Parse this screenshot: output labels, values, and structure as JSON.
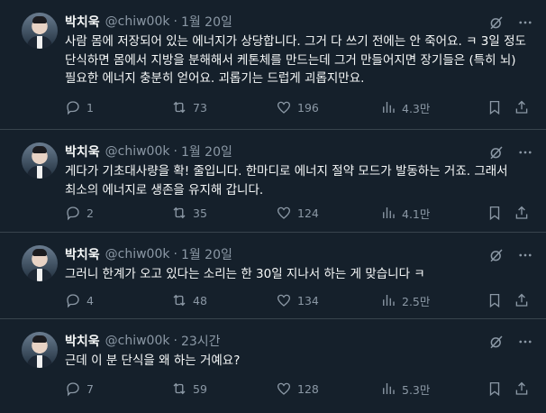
{
  "tweets": [
    {
      "author": "박치욱",
      "handle": "@chiw00k",
      "separator": "·",
      "time": "1월 20일",
      "text": "사람 몸에 저장되어 있는 에너지가 상당합니다. 그거 다 쓰기 전에는 안 죽어요. ㅋ 3일 정도 단식하면 몸에서 지방을 분해해서 케톤체를 만드는데 그거 만들어지면 장기들은 (특히 뇌) 필요한 에너지 충분히 얻어요. 괴롭기는 드럽게 괴롭지만요.",
      "replies": "1",
      "retweets": "73",
      "likes": "196",
      "views": "4.3만"
    },
    {
      "author": "박치욱",
      "handle": "@chiw00k",
      "separator": "·",
      "time": "1월 20일",
      "text": "게다가 기초대사량을 확! 줄입니다. 한마디로 에너지 절약 모드가 발동하는 거죠. 그래서 최소의 에너지로 생존을 유지해 갑니다.",
      "replies": "2",
      "retweets": "35",
      "likes": "124",
      "views": "4.1만"
    },
    {
      "author": "박치욱",
      "handle": "@chiw00k",
      "separator": "·",
      "time": "1월 20일",
      "text": "그러니 한계가 오고 있다는 소리는 한 30일 지나서 하는 게 맞습니다 ㅋ",
      "replies": "4",
      "retweets": "48",
      "likes": "134",
      "views": "2.5만"
    },
    {
      "author": "박치욱",
      "handle": "@chiw00k",
      "separator": "·",
      "time": "23시간",
      "text": "근데 이 분 단식을 왜 하는 거예요?",
      "replies": "7",
      "retweets": "59",
      "likes": "128",
      "views": "5.3만"
    }
  ],
  "icons": {
    "reply": "reply-icon",
    "retweet": "retweet-icon",
    "like": "heart-icon",
    "views": "views-icon",
    "bookmark": "bookmark-icon",
    "share": "share-icon",
    "grok": "grok-icon",
    "more": "more-icon"
  },
  "colors": {
    "background": "#15202b",
    "text": "#f7f9f9",
    "secondary": "#8b98a5",
    "divider": "#38444d"
  }
}
